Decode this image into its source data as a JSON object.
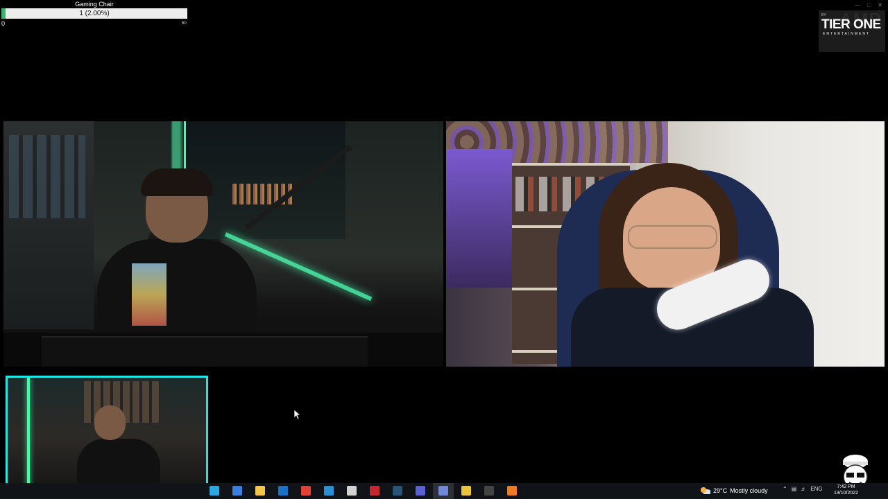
{
  "goal": {
    "title": "Gaming Chair",
    "progress_text": "1 (2.00%)",
    "progress": 0.02,
    "min": "0",
    "max": "50",
    "fill_color": "#31b86a"
  },
  "brand": {
    "by": "BY",
    "name": "TIER ONE",
    "sub": "ENTERTAINMENT",
    "watermark": "AMP"
  },
  "window_controls": [
    "minimize",
    "maximize",
    "close"
  ],
  "accent_colors": {
    "pip_border": "#1ee8e6",
    "led": "#3effa6"
  },
  "taskbar": {
    "icons": [
      {
        "name": "edge-icon",
        "color": "#2aa8e0"
      },
      {
        "name": "store-icon",
        "color": "#3b7de0"
      },
      {
        "name": "file-explorer-icon",
        "color": "#f2c54b"
      },
      {
        "name": "outlook-icon",
        "color": "#1a73c9"
      },
      {
        "name": "chrome-icon",
        "color": "#e34133"
      },
      {
        "name": "app-blue-icon",
        "color": "#2b8fd6"
      },
      {
        "name": "app-paint-icon",
        "color": "#d2d2d2"
      },
      {
        "name": "app-red-icon",
        "color": "#c7262e"
      },
      {
        "name": "steam-icon",
        "color": "#2a5477"
      },
      {
        "name": "app-purple-icon",
        "color": "#5a5fd1"
      },
      {
        "name": "discord-icon",
        "color": "#7289da"
      },
      {
        "name": "app-yellow-icon",
        "color": "#e8c53a"
      },
      {
        "name": "obs-icon",
        "color": "#444444"
      },
      {
        "name": "app-orange-icon",
        "color": "#f07b1f"
      }
    ],
    "active_icon_index": 10,
    "weather": {
      "temp": "29°C",
      "condition": "Mostly cloudy"
    },
    "language": "ENG",
    "time": "7:42 PM",
    "date": "13/10/2022"
  }
}
